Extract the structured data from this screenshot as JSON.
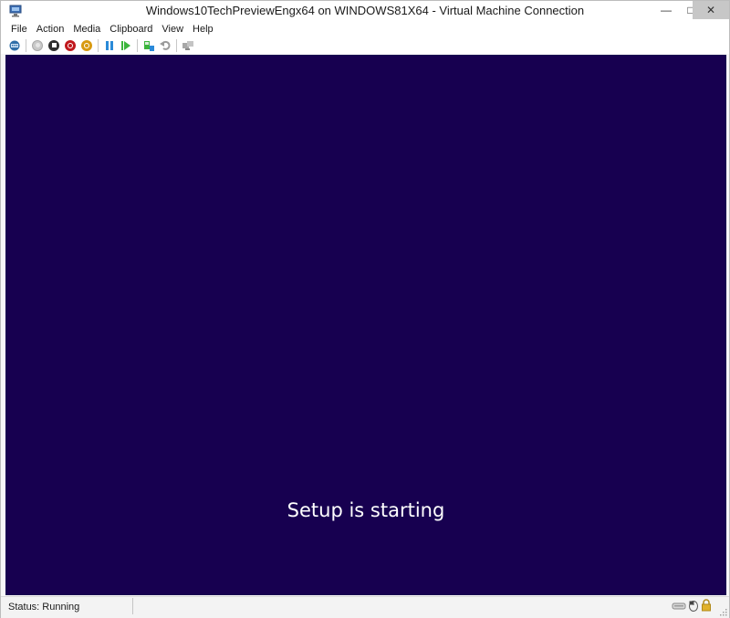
{
  "window": {
    "title": "Windows10TechPreviewEngx64 on WINDOWS81X64 - Virtual Machine Connection",
    "minimize_glyph": "—",
    "maximize_glyph": "□",
    "close_glyph": "✕"
  },
  "menu": {
    "items": [
      "File",
      "Action",
      "Media",
      "Clipboard",
      "View",
      "Help"
    ]
  },
  "toolbar": {
    "buttons": [
      {
        "name": "ctrl-alt-del-icon"
      },
      {
        "name": "start-icon",
        "color": "#b9b9b9"
      },
      {
        "name": "turn-off-icon",
        "color": "#2e2e2e"
      },
      {
        "name": "shut-down-icon",
        "color": "#c0181d"
      },
      {
        "name": "save-icon",
        "color": "#d89a12"
      },
      {
        "name": "pause-icon",
        "color": "#2a8ad8"
      },
      {
        "name": "reset-icon",
        "color": "#3cb53c"
      },
      {
        "name": "checkpoint-icon",
        "color": "#3cb53c"
      },
      {
        "name": "revert-icon",
        "color": "#9a9a9a"
      },
      {
        "name": "enhanced-session-icon",
        "color": "#9a9a9a"
      }
    ]
  },
  "vm": {
    "background": "#170050",
    "message": "Setup is starting"
  },
  "status": {
    "text": "Status: Running"
  }
}
